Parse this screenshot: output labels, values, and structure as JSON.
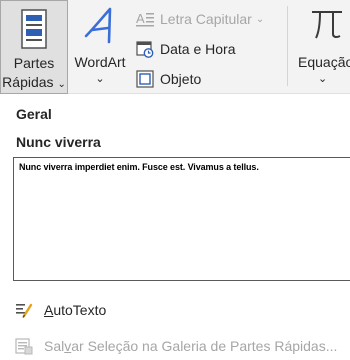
{
  "ribbon": {
    "partes_rapidas": {
      "line1": "Partes",
      "line2": "Rápidas",
      "chevron": "⌄"
    },
    "wordart": {
      "label": "WordArt",
      "chevron": "⌄"
    },
    "letra_capitular": {
      "label": "Letra Capitular",
      "chevron": "⌄",
      "enabled": false
    },
    "data_hora": {
      "label": "Data e Hora"
    },
    "objeto": {
      "label": "Objeto"
    },
    "equacao": {
      "label": "Equação",
      "chevron": "⌄"
    }
  },
  "gallery": {
    "category": "Geral",
    "entry": {
      "name": "Nunc viverra",
      "preview": "Nunc viverra imperdiet enim. Fusce est. Vivamus a tellus."
    }
  },
  "menu": {
    "autotexto": {
      "first": "A",
      "rest": "utoTexto"
    },
    "salvar": {
      "first": "Sal",
      "u": "v",
      "rest": "ar Seleção na Galeria de Partes Rápidas...",
      "enabled": false
    }
  },
  "colors": {
    "ribbon_bg": "#f3f3f3",
    "accent_blue": "#2f5fb3",
    "wordart_blue": "#3b6fd8",
    "disabled_text": "#a6a6a6"
  }
}
